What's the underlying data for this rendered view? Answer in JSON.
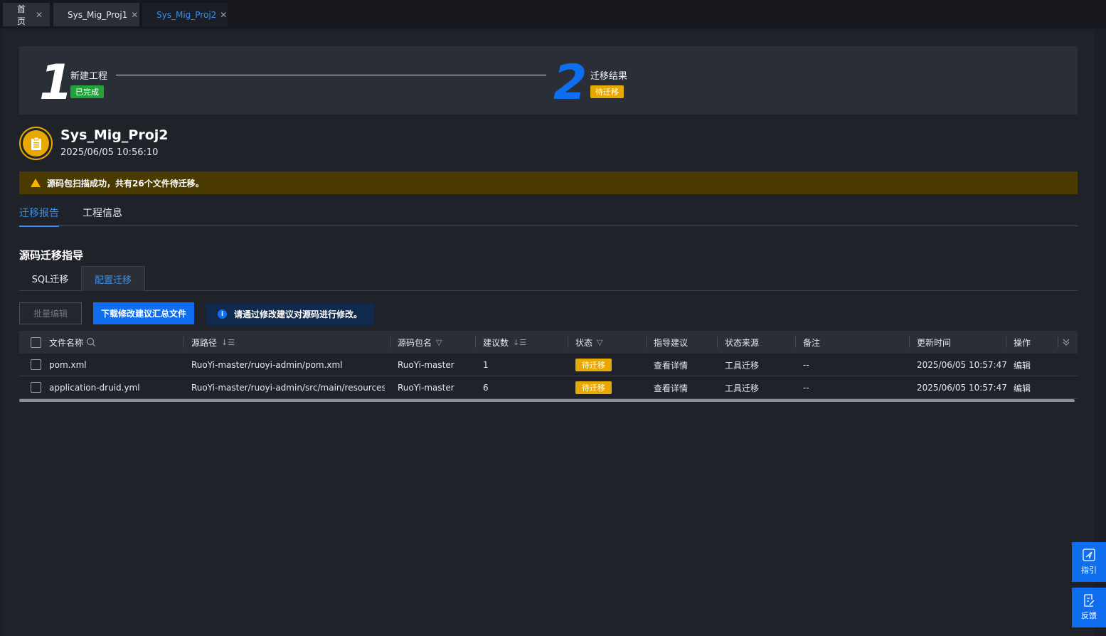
{
  "tabs": [
    {
      "label": "首页"
    },
    {
      "label": "Sys_Mig_Proj1"
    },
    {
      "label": "Sys_Mig_Proj2"
    }
  ],
  "steps": [
    {
      "num": "1",
      "title": "新建工程",
      "badge": "已完成",
      "badge_color": "#1fa33a",
      "num_color": "#ffffff"
    },
    {
      "num": "2",
      "title": "迁移结果",
      "badge": "待迁移",
      "badge_color": "#e7a800",
      "num_color": "#0f6ef0"
    }
  ],
  "project": {
    "name": "Sys_Mig_Proj2",
    "time": "2025/06/05 10:56:10"
  },
  "alert": {
    "text": "源码包扫描成功，共有26个文件待迁移。"
  },
  "report_tabs": [
    {
      "label": "迁移报告"
    },
    {
      "label": "工程信息"
    }
  ],
  "section_title": "源码迁移指导",
  "sub_tabs": [
    {
      "label": "SQL迁移"
    },
    {
      "label": "配置迁移"
    }
  ],
  "buttons": {
    "batch_edit": "批量编辑",
    "download": "下载修改建议汇总文件"
  },
  "hint": {
    "icon": "i",
    "text": "请通过修改建议对源码进行修改。"
  },
  "table": {
    "columns": [
      "文件名称",
      "源路径",
      "源码包名",
      "建议数",
      "状态",
      "指导建议",
      "状态来源",
      "备注",
      "更新时间",
      "操作"
    ],
    "rows": [
      {
        "file": "pom.xml",
        "path": "RuoYi-master/ruoyi-admin/pom.xml",
        "package": "RuoYi-master",
        "count": "1",
        "status": "待迁移",
        "guide": "查看详情",
        "source": "工具迁移",
        "note": "--",
        "time": "2025/06/05 10:57:47",
        "action": "编辑"
      },
      {
        "file": "application-druid.yml",
        "path": "RuoYi-master/ruoyi-admin/src/main/resources/...",
        "package": "RuoYi-master",
        "count": "6",
        "status": "待迁移",
        "guide": "查看详情",
        "source": "工具迁移",
        "note": "--",
        "time": "2025/06/05 10:57:47",
        "action": "编辑"
      }
    ]
  },
  "float": {
    "guide": "指引",
    "feedback": "反馈"
  }
}
